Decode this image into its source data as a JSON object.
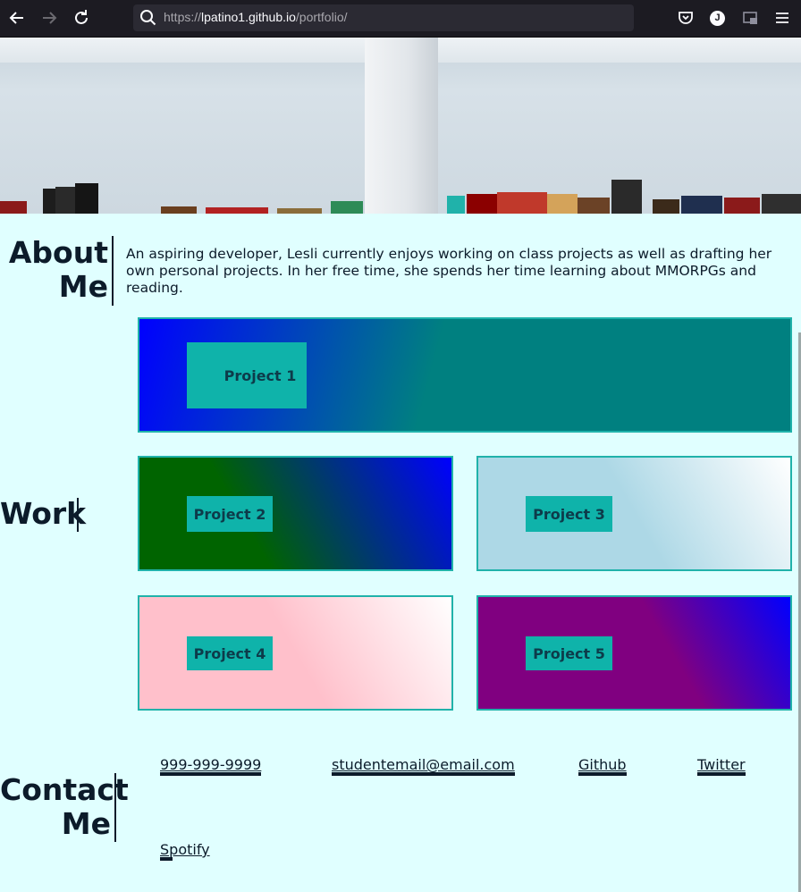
{
  "browser": {
    "url_prefix": "https://",
    "url_host": "lpatino1.github.io",
    "url_path": "/portfolio/",
    "account_initial": "J"
  },
  "about": {
    "title_line1": "About",
    "title_line2": "Me",
    "text": "An aspiring developer, Lesli currently enjoys working on class projects as well as drafting her own personal projects. In her free time, she spends her time learning about MMORPGs and reading."
  },
  "work": {
    "title": "Work",
    "projects": [
      {
        "label": "Project 1"
      },
      {
        "label": "Project 2"
      },
      {
        "label": "Project 3"
      },
      {
        "label": "Project 4"
      },
      {
        "label": "Project 5"
      }
    ]
  },
  "contact": {
    "title_line1": "Contact",
    "title_line2": "Me",
    "phone": "999-999-9999",
    "email": "studentemail@email.com",
    "github": "Github",
    "twitter": "Twitter",
    "spotify": "Spotify"
  },
  "colors": {
    "background": "#e0ffff",
    "card_border": "#20b2aa",
    "label_bg": "#0fb3aa",
    "text": "#0c1b2a"
  }
}
